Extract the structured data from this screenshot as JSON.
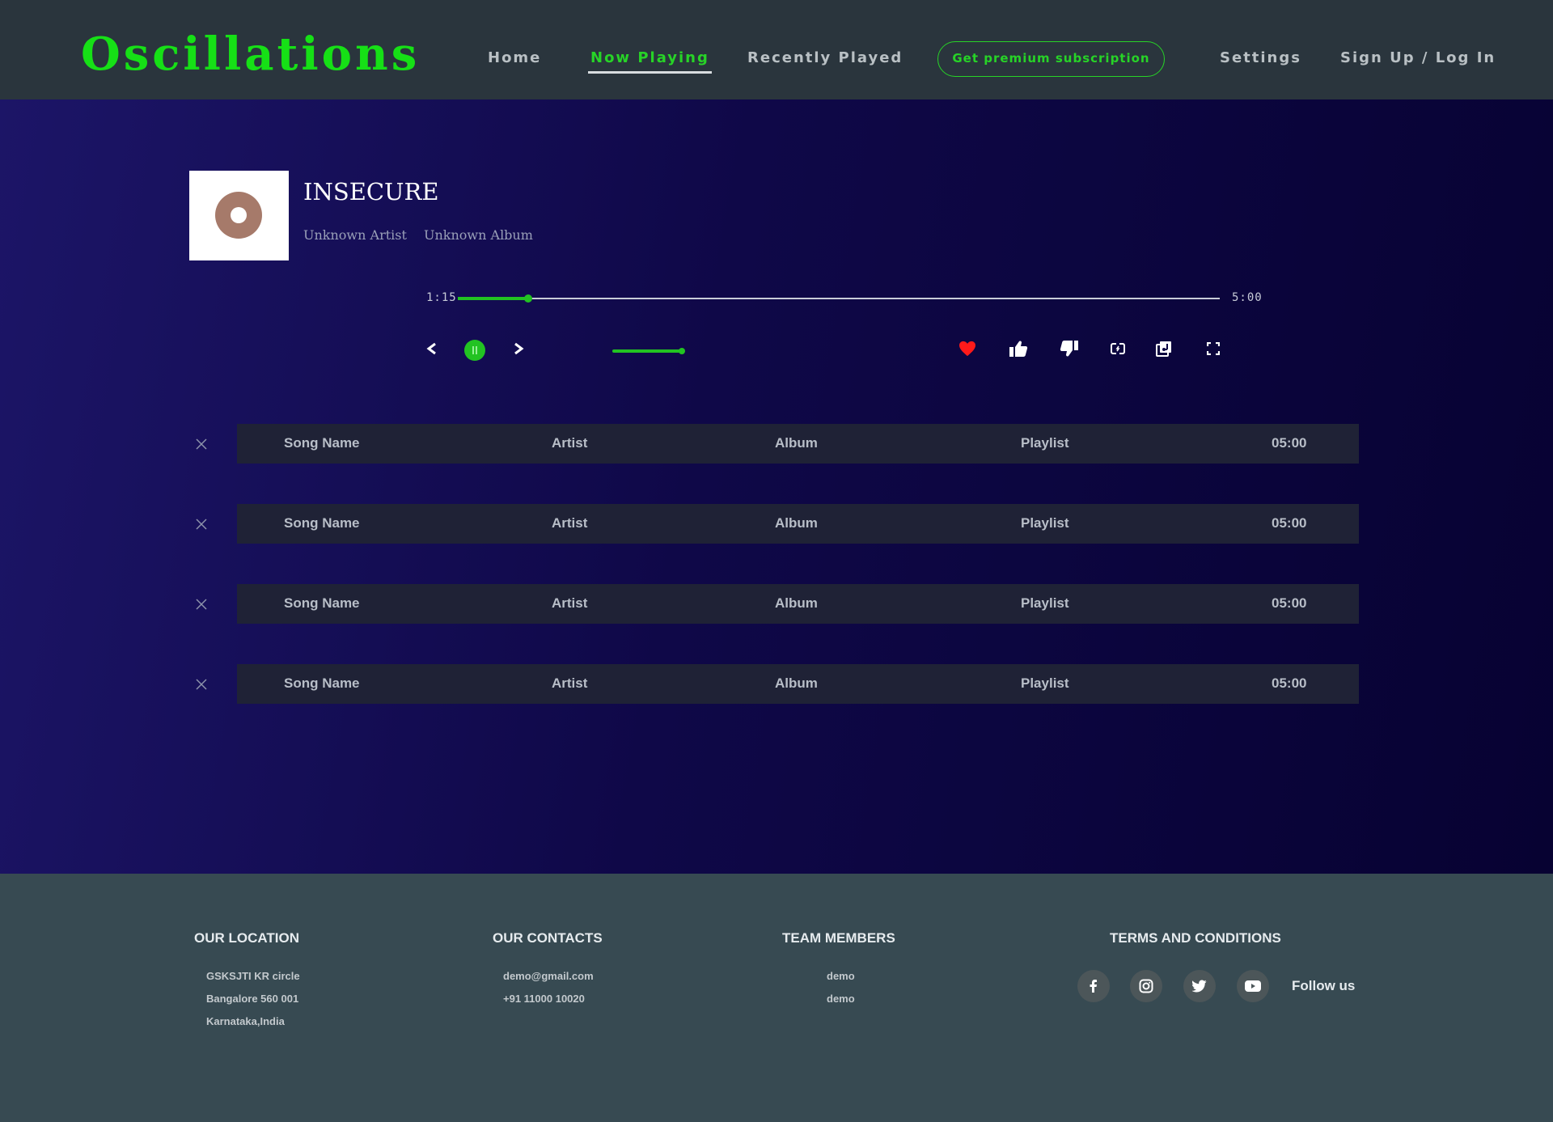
{
  "header": {
    "brand": "Oscillations",
    "nav": [
      "Home",
      "Now Playing",
      "Recently Played"
    ],
    "premium": "Get premium subscription",
    "settings": "Settings",
    "auth": "Sign Up / Log In"
  },
  "player": {
    "title": "INSECURE",
    "artist": "Unknown Artist",
    "album": "Unknown Album",
    "elapsed": "1:15",
    "duration": "5:00",
    "progress_fraction": 0.092,
    "volume_fraction": 1.0
  },
  "queue": [
    {
      "song": "Song Name",
      "artist": "Artist",
      "album": "Album",
      "playlist": "Playlist",
      "length": "05:00"
    },
    {
      "song": "Song Name",
      "artist": "Artist",
      "album": "Album",
      "playlist": "Playlist",
      "length": "05:00"
    },
    {
      "song": "Song Name",
      "artist": "Artist",
      "album": "Album",
      "playlist": "Playlist",
      "length": "05:00"
    },
    {
      "song": "Song Name",
      "artist": "Artist",
      "album": "Album",
      "playlist": "Playlist",
      "length": "05:00"
    }
  ],
  "footer": {
    "location_title": "OUR LOCATION",
    "location_lines": [
      "GSKSJTI KR circle",
      "Bangalore 560 001",
      "Karnataka,India"
    ],
    "contacts_title": "OUR CONTACTS",
    "contact_lines": [
      "demo@gmail.com",
      "+91 11000 10020"
    ],
    "team_title": "TEAM MEMBERS",
    "team_lines": [
      "demo",
      "demo"
    ],
    "terms_title": "TERMS AND CONDITIONS",
    "follow": "Follow us"
  },
  "icons": {
    "social": [
      "facebook-icon",
      "instagram-icon",
      "twitter-icon",
      "youtube-icon"
    ],
    "controls": [
      "previous-icon",
      "pause-icon",
      "next-icon",
      "heart-icon",
      "thumbs-up-icon",
      "thumbs-down-icon",
      "repeat-icon",
      "add-to-playlist-icon",
      "fullscreen-icon"
    ]
  },
  "colors": {
    "accent": "#22c322",
    "brand": "#16e016",
    "heart": "#ff1a1a"
  }
}
